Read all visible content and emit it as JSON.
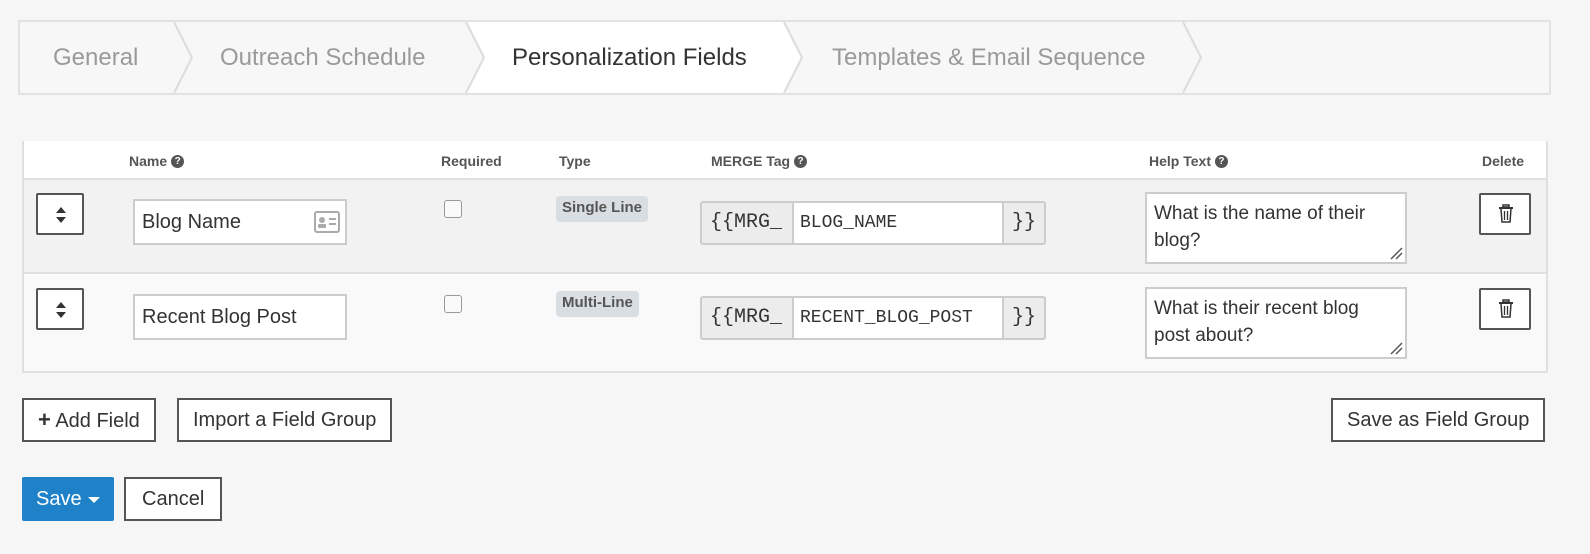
{
  "wizard": {
    "steps": [
      {
        "label": "General",
        "active": false
      },
      {
        "label": "Outreach Schedule",
        "active": false
      },
      {
        "label": "Personalization Fields",
        "active": true
      },
      {
        "label": "Templates & Email Sequence",
        "active": false
      }
    ]
  },
  "table": {
    "headers": {
      "name": "Name",
      "required": "Required",
      "type": "Type",
      "merge_tag": "MERGE Tag",
      "help_text": "Help Text",
      "delete": "Delete"
    },
    "help_glyph": "?",
    "rows": [
      {
        "name": "Blog Name",
        "required": false,
        "type": "Single Line",
        "merge_prefix": "{{MRG_",
        "merge_value": "BLOG_NAME",
        "merge_suffix": "}}",
        "help_text": "What is the name of their blog?"
      },
      {
        "name": "Recent Blog Post",
        "required": false,
        "type": "Multi-Line",
        "merge_prefix": "{{MRG_",
        "merge_value": "RECENT_BLOG_POST",
        "merge_suffix": "}}",
        "help_text": "What is their recent blog post about?"
      }
    ]
  },
  "actions": {
    "add_field": "Add Field",
    "add_icon": "+",
    "import_group": "Import a Field Group",
    "save_group": "Save as Field Group",
    "save": "Save",
    "cancel": "Cancel"
  },
  "icons": {
    "sort": "sort-arrows-icon",
    "contact_card": "contact-card-icon",
    "trash": "trash-icon",
    "help": "question-circle-icon"
  },
  "colors": {
    "primary": "#1f82c9",
    "badge_bg": "#d9dee2",
    "inactive_step_text": "#9a9a9a"
  }
}
